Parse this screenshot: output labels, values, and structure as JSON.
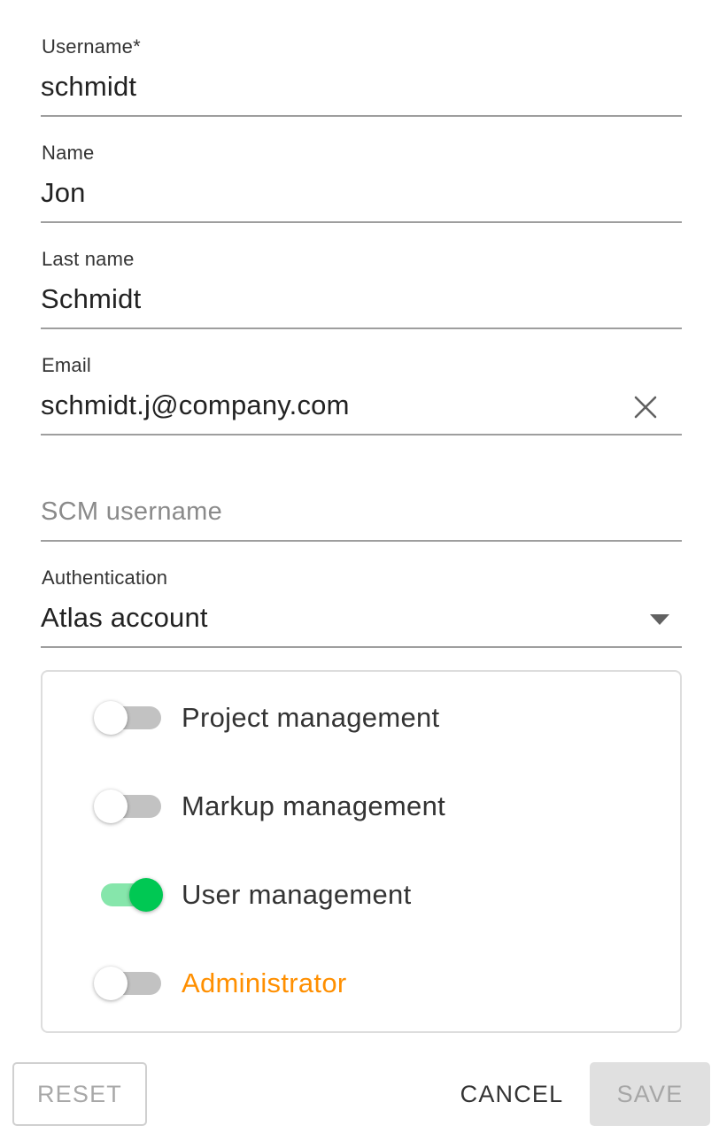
{
  "form": {
    "username": {
      "label": "Username*",
      "value": "schmidt"
    },
    "name": {
      "label": "Name",
      "value": "Jon"
    },
    "last_name": {
      "label": "Last name",
      "value": "Schmidt"
    },
    "email": {
      "label": "Email",
      "value": "schmidt.j@company.com",
      "clear_icon": "close-icon"
    },
    "scm_username": {
      "placeholder": "SCM username",
      "value": ""
    },
    "authentication": {
      "label": "Authentication",
      "value": "Atlas account",
      "dropdown_icon": "arrow-drop-down-icon"
    }
  },
  "roles": [
    {
      "label": "Project management",
      "enabled": false
    },
    {
      "label": "Markup management",
      "enabled": false
    },
    {
      "label": "User management",
      "enabled": true
    },
    {
      "label": "Administrator",
      "enabled": false
    }
  ],
  "colors": {
    "switch_on_thumb": "#00c853",
    "switch_on_track": "#86e6ab",
    "switch_off_track": "#c2c2c2",
    "administrator_label": "#ff8f00"
  },
  "actions": {
    "reset_label": "RESET",
    "reset_enabled": false,
    "cancel_label": "CANCEL",
    "save_label": "SAVE",
    "save_enabled": false
  }
}
